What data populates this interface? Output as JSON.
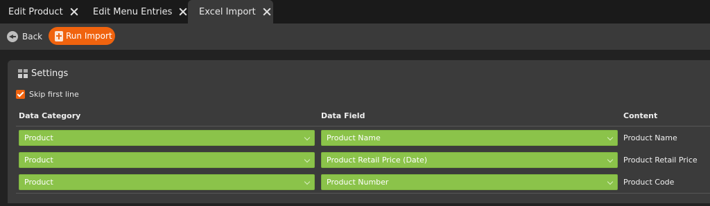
{
  "tabs": [
    {
      "label": "Edit Product",
      "active": false
    },
    {
      "label": "Edit Menu Entries",
      "active": false
    },
    {
      "label": "Excel Import",
      "active": true
    }
  ],
  "toolbar": {
    "back_label": "Back",
    "run_import_label": "Run Import"
  },
  "settings": {
    "title": "Settings",
    "skip_first_line": {
      "label": "Skip first line",
      "checked": true
    },
    "columns": {
      "category": "Data Category",
      "field": "Data Field",
      "content": "Content"
    },
    "rows": [
      {
        "category": "Product",
        "field": "Product Name",
        "content": "Product Name"
      },
      {
        "category": "Product",
        "field": "Product Retail Price (Date)",
        "content": "Product Retail Price"
      },
      {
        "category": "Product",
        "field": "Product Number",
        "content": "Product Code"
      }
    ]
  },
  "colors": {
    "accent": "#f0630e",
    "select_green": "#8bc34a",
    "panel": "#3b3b3b",
    "background": "#222222"
  },
  "icons": {
    "tab_close": "close-icon",
    "back": "back-arrow-icon",
    "run_import": "import-plus-icon",
    "settings": "grid-icon",
    "dropdown": "chevron-down-icon"
  }
}
